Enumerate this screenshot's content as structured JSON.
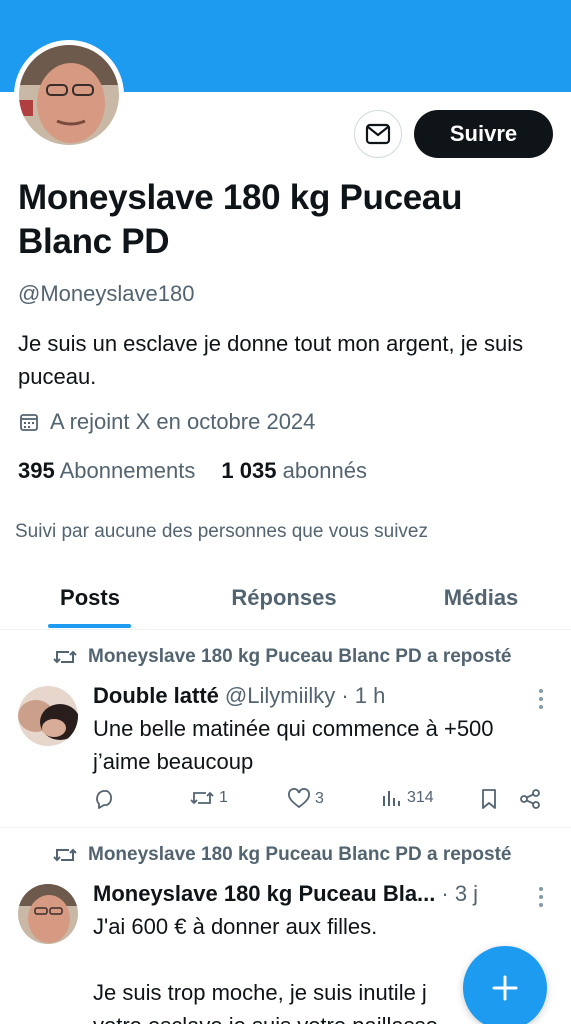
{
  "profile": {
    "name": "Moneyslave 180 kg Puceau Blanc PD",
    "handle": "@Moneyslave180",
    "bio": "Je suis un esclave je donne tout mon argent, je suis puceau.",
    "joined": "A rejoint X en octobre 2024",
    "following_count": "395",
    "following_label": "Abonnements",
    "followers_count": "1 035",
    "followers_label": "abonnés",
    "followed_by": "Suivi par aucune des personnes que vous suivez",
    "follow_button": "Suivre"
  },
  "tabs": [
    "Posts",
    "Réponses",
    "Médias"
  ],
  "active_tab": "Posts",
  "posts": [
    {
      "repost_label": "Moneyslave 180 kg Puceau Blanc PD a reposté",
      "author": "Double latté",
      "meta": "@Lilymiilky · 1 h",
      "text_lines": [
        "Une belle matinée qui commence à +500",
        "j’aime beaucoup"
      ],
      "replies": "",
      "reposts": "1",
      "likes": "3",
      "views": "314"
    },
    {
      "repost_label": "Moneyslave 180 kg Puceau Blanc PD a reposté",
      "author": "Moneyslave 180 kg Puceau Bla...",
      "meta": "· 3 j",
      "text_lines": [
        "J'ai 600 € à donner aux filles.",
        "",
        "Je suis trop moche, je suis inutile j",
        "votre esclave je suis votre paillasso"
      ]
    }
  ],
  "icons": [
    "mail-icon",
    "calendar-icon",
    "repost-icon",
    "more-icon",
    "reply-icon",
    "like-icon",
    "views-icon",
    "bookmark-icon",
    "share-icon",
    "plus-icon"
  ],
  "colors": {
    "accent": "#1d9bf0",
    "text": "#0f1419",
    "secondary": "#536471",
    "button_dark": "#0f1419"
  }
}
